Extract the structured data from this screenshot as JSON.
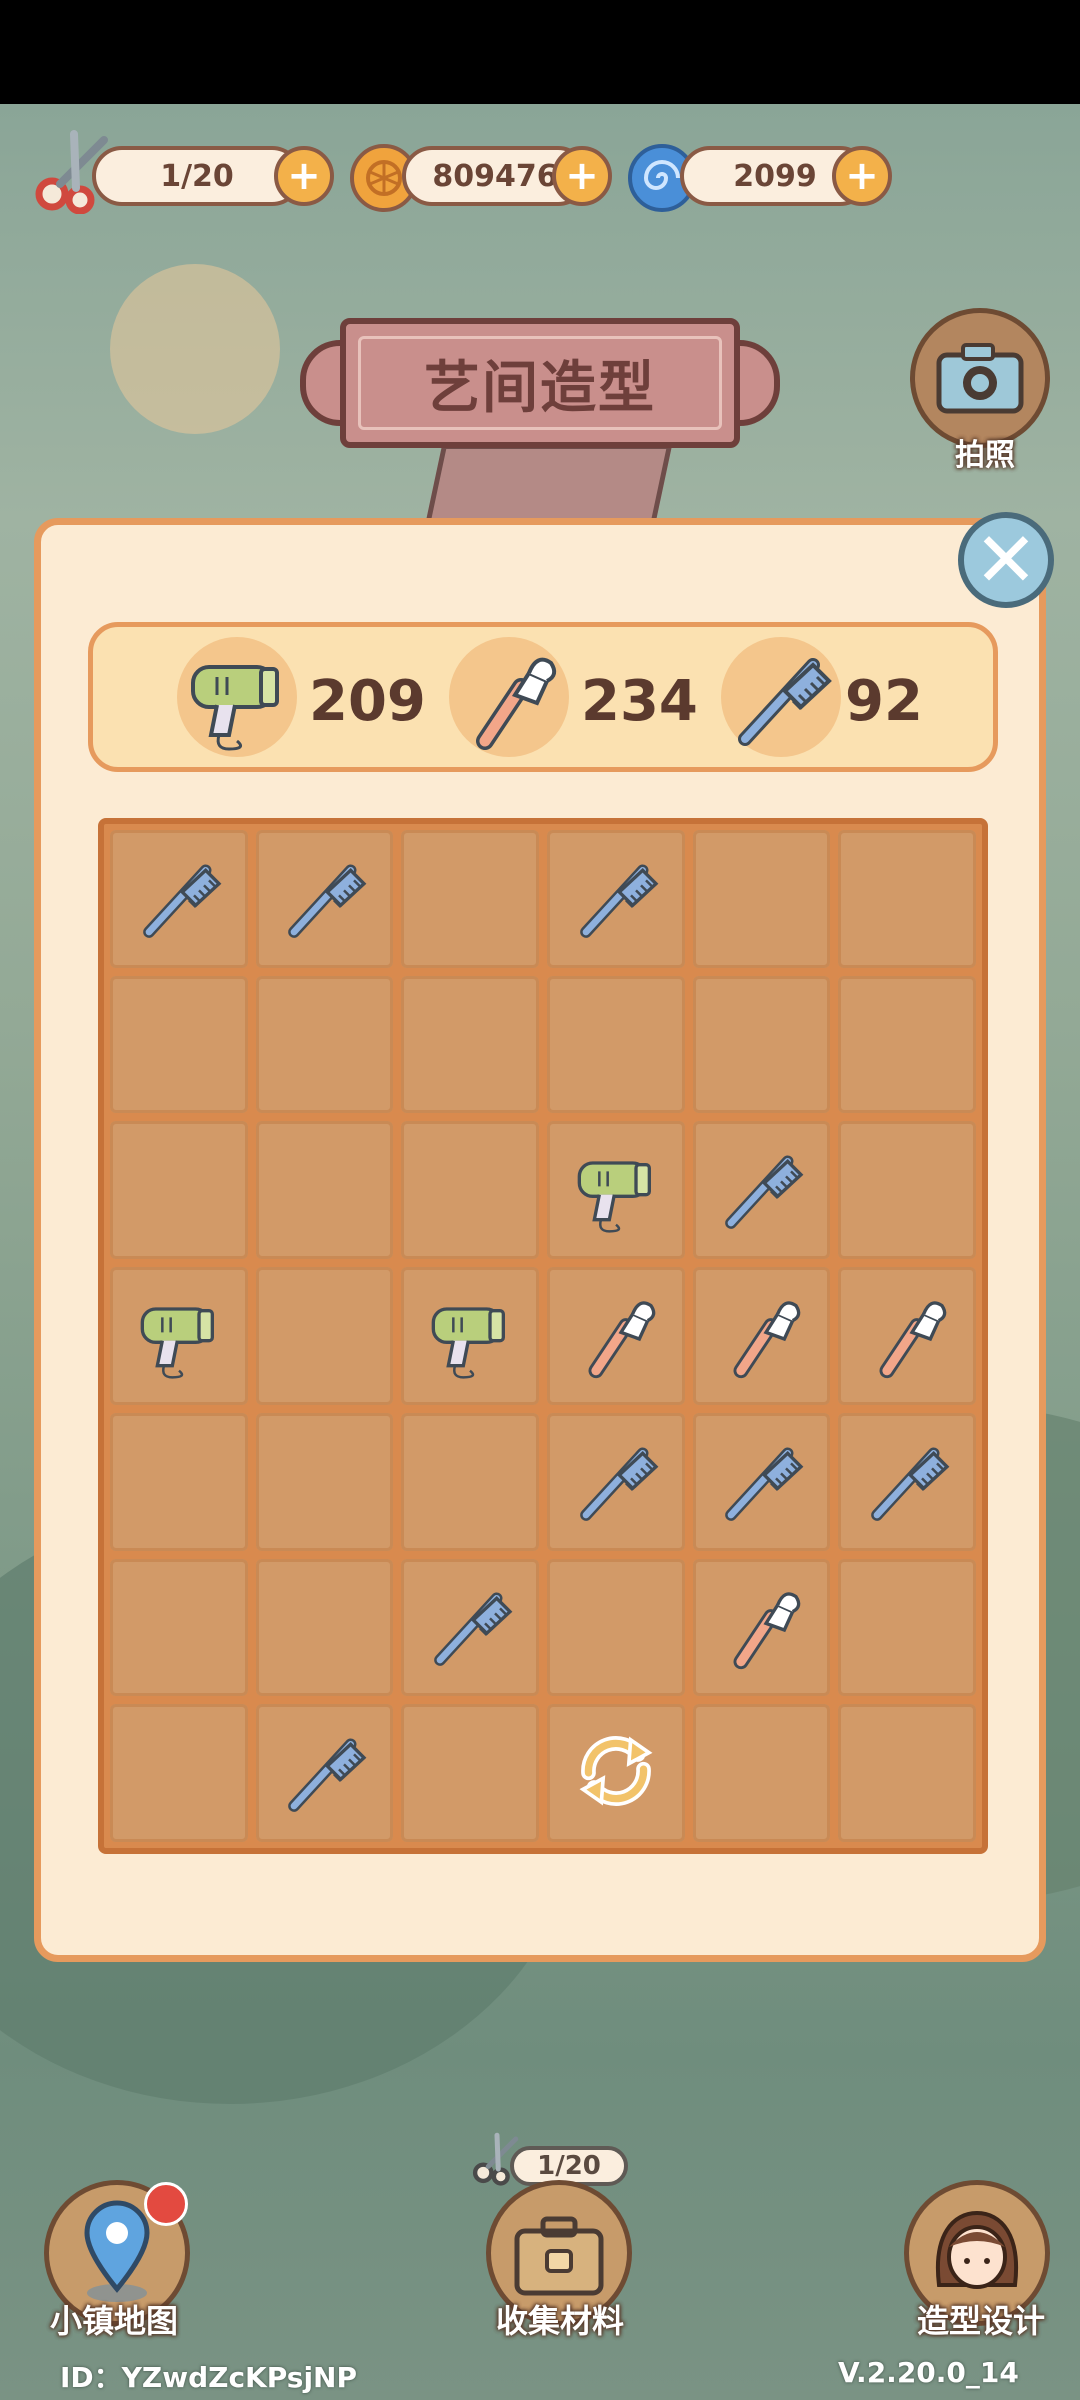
{
  "topbar": {
    "scissors": "1/20",
    "coins": "809476",
    "swirl": "2099"
  },
  "title": "艺间造型",
  "camera_label": "拍照",
  "counters": [
    {
      "icon": "hair-dryer-icon",
      "value": "209"
    },
    {
      "icon": "makeup-brush-icon",
      "value": "234"
    },
    {
      "icon": "comb-icon",
      "value": "92"
    }
  ],
  "grid": [
    [
      "comb",
      "comb",
      "",
      "comb",
      "",
      ""
    ],
    [
      "",
      "",
      "",
      "",
      "",
      ""
    ],
    [
      "",
      "",
      "",
      "dryer",
      "comb",
      ""
    ],
    [
      "dryer",
      "",
      "dryer",
      "brush",
      "brush",
      "brush"
    ],
    [
      "",
      "",
      "",
      "comb",
      "comb",
      "comb"
    ],
    [
      "",
      "",
      "comb",
      "",
      "brush",
      ""
    ],
    [
      "",
      "comb",
      "",
      "refresh",
      "",
      ""
    ]
  ],
  "bottom": {
    "map_label": "小镇地图",
    "collect_label": "收集材料",
    "collect_count": "1/20",
    "design_label": "造型设计",
    "user_id": "ID：YZwdZcKPsjNP",
    "version": "V.2.20.0_14"
  },
  "colors": {
    "panel_bg": "#fcebd3",
    "panel_border": "#e69a5d",
    "grid_bg": "#d98a4e",
    "cell_bg": "#d29a68",
    "banner": "#c98f8c"
  }
}
